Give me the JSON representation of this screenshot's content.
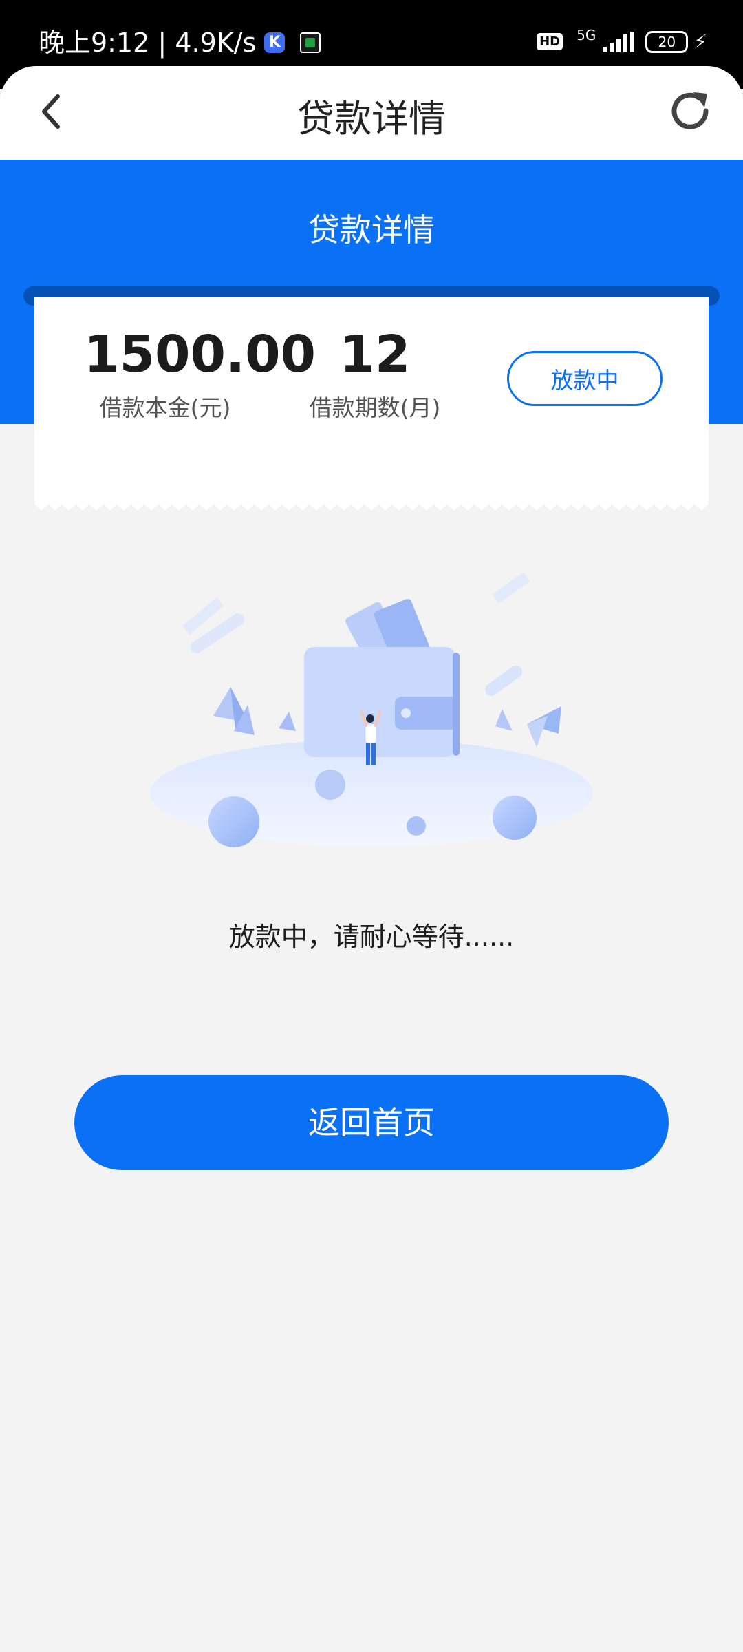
{
  "status_bar": {
    "time": "晚上9:12",
    "net_speed": "4.9K/s",
    "app_k": "K",
    "hd": "HD",
    "network": "5G",
    "battery": "20"
  },
  "nav": {
    "title": "贷款详情",
    "back_icon": "chevron-left-icon",
    "refresh_icon": "refresh-icon"
  },
  "banner": {
    "title": "贷款详情"
  },
  "loan": {
    "principal": "1500.00",
    "principal_label": "借款本金(元)",
    "periods": "12",
    "periods_label": "借款期数(月)",
    "status": "放款中"
  },
  "message": "放款中，请耐心等待......",
  "home_button": "返回首页",
  "colors": {
    "accent": "#0a71f7",
    "background": "#f3f3f3",
    "slot": "#0451b6"
  }
}
